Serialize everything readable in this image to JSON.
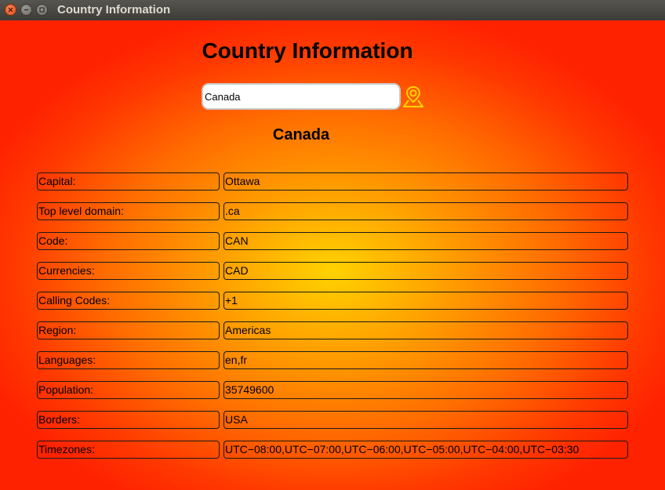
{
  "window": {
    "title": "Country Information"
  },
  "header": {
    "title": "Country Information"
  },
  "search": {
    "value": "Canada",
    "button_icon": "map-pin-icon"
  },
  "country": {
    "name": "Canada"
  },
  "fields": [
    {
      "label": "Capital:",
      "value": "Ottawa"
    },
    {
      "label": "Top level domain:",
      "value": ".ca"
    },
    {
      "label": "Code:",
      "value": "CAN"
    },
    {
      "label": "Currencies:",
      "value": "CAD"
    },
    {
      "label": "Calling Codes:",
      "value": "+1"
    },
    {
      "label": "Region:",
      "value": "Americas"
    },
    {
      "label": "Languages:",
      "value": "en,fr"
    },
    {
      "label": "Population:",
      "value": "35749600"
    },
    {
      "label": "Borders:",
      "value": "USA"
    },
    {
      "label": "Timezones:",
      "value": "UTC−08:00,UTC−07:00,UTC−06:00,UTC−05:00,UTC−04:00,UTC−03:30"
    }
  ],
  "colors": {
    "background_center": "#ffd200",
    "background_edge": "#ff2200",
    "icon_accent": "#ffd500"
  }
}
